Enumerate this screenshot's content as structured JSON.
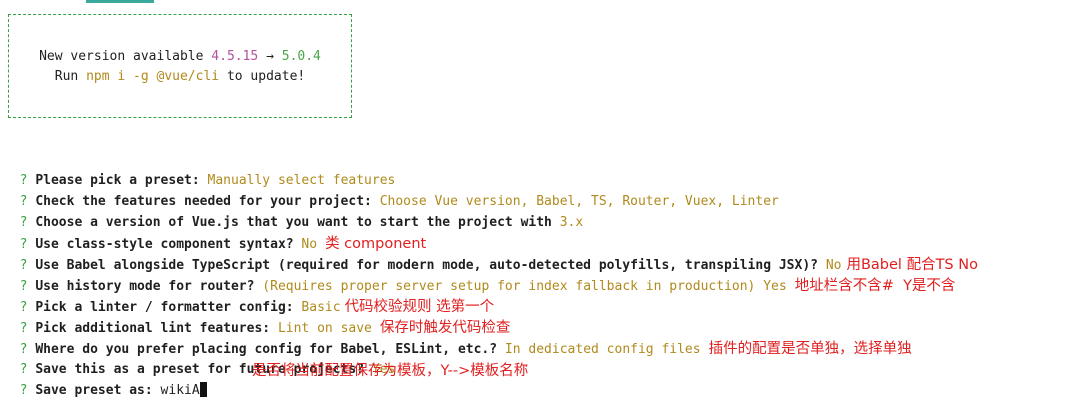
{
  "box": {
    "version_prefix": "New version available",
    "current_version": "4.5.15",
    "arrow": "→",
    "new_version": "5.0.4",
    "run_label": "Run",
    "command": "npm i -g @vue/cli",
    "update_suffix": "to update!"
  },
  "prompt_mark": "?",
  "lines": [
    {
      "question": "Please pick a preset:",
      "answer": "Manually select features",
      "note": ""
    },
    {
      "question": "Check the features needed for your project:",
      "answer": "Choose Vue version, Babel, TS, Router, Vuex, Linter",
      "note": ""
    },
    {
      "question": "Choose a version of Vue.js that you want to start the project with",
      "answer": "3.x",
      "note": ""
    },
    {
      "question": "Use class-style component syntax?",
      "answer": "No",
      "note": "类 component"
    },
    {
      "question": "Use Babel alongside TypeScript (required for modern mode, auto-detected polyfills, transpiling JSX)?",
      "answer": "No",
      "note": "用Babel 配合TS No"
    },
    {
      "question": "Use history mode for router?",
      "hint": "(Requires proper server setup for index fallback in production)",
      "answer": "Yes",
      "note": "地址栏含不含#  Y是不含"
    },
    {
      "question": "Pick a linter / formatter config:",
      "answer": "Basic",
      "note": "代码校验规则 选第一个"
    },
    {
      "question": "Pick additional lint features:",
      "answer": "Lint on save",
      "note": "保存时触发代码检查"
    },
    {
      "question": "Where do you prefer placing config for Babel, ESLint, etc.?",
      "answer": "In dedicated config files",
      "note": "插件的配置是否单独，选择单独"
    },
    {
      "question": "Save this as a preset for future projects?",
      "answer": "Yes",
      "note": ""
    },
    {
      "question": "Save preset as:",
      "answer": "wikiA",
      "note": "是否将当前配置保存为模板，Y-->模板名称"
    }
  ]
}
